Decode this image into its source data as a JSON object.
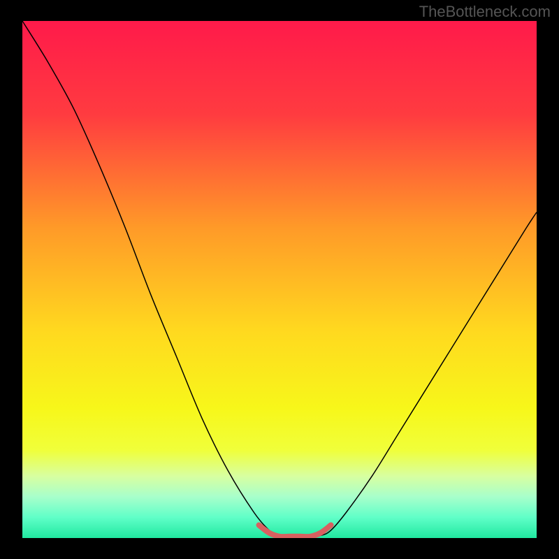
{
  "watermark": "TheBottleneck.com",
  "chart_data": {
    "type": "line",
    "title": "",
    "xlabel": "",
    "ylabel": "",
    "xlim": [
      0,
      100
    ],
    "ylim": [
      0,
      100
    ],
    "background_gradient": {
      "stops": [
        {
          "pos": 0,
          "color": "#ff1a4a"
        },
        {
          "pos": 18,
          "color": "#ff3b40"
        },
        {
          "pos": 40,
          "color": "#ff9a28"
        },
        {
          "pos": 60,
          "color": "#ffd91f"
        },
        {
          "pos": 75,
          "color": "#f7f71a"
        },
        {
          "pos": 83,
          "color": "#f0ff3a"
        },
        {
          "pos": 88,
          "color": "#d8ffa0"
        },
        {
          "pos": 92,
          "color": "#a8ffcb"
        },
        {
          "pos": 96,
          "color": "#60ffc8"
        },
        {
          "pos": 100,
          "color": "#20e8a0"
        }
      ]
    },
    "series": [
      {
        "name": "bottleneck-curve",
        "color": "#000000",
        "width": 1.5,
        "x": [
          0,
          5,
          10,
          15,
          20,
          25,
          30,
          35,
          40,
          45,
          48,
          50,
          52,
          55,
          58,
          60,
          63,
          68,
          73,
          78,
          83,
          88,
          93,
          98,
          100
        ],
        "y": [
          100,
          92,
          83,
          72,
          60,
          47,
          35,
          23,
          13,
          5,
          1.5,
          0.5,
          0.3,
          0.3,
          0.5,
          1.5,
          5,
          12,
          20,
          28,
          36,
          44,
          52,
          60,
          63
        ]
      },
      {
        "name": "optimal-zone-marker",
        "color": "#d86060",
        "width": 8,
        "x": [
          46,
          48,
          50,
          52,
          54,
          56,
          58,
          60
        ],
        "y": [
          2.5,
          1.0,
          0.3,
          0.3,
          0.3,
          0.3,
          1.0,
          2.5
        ]
      }
    ]
  }
}
